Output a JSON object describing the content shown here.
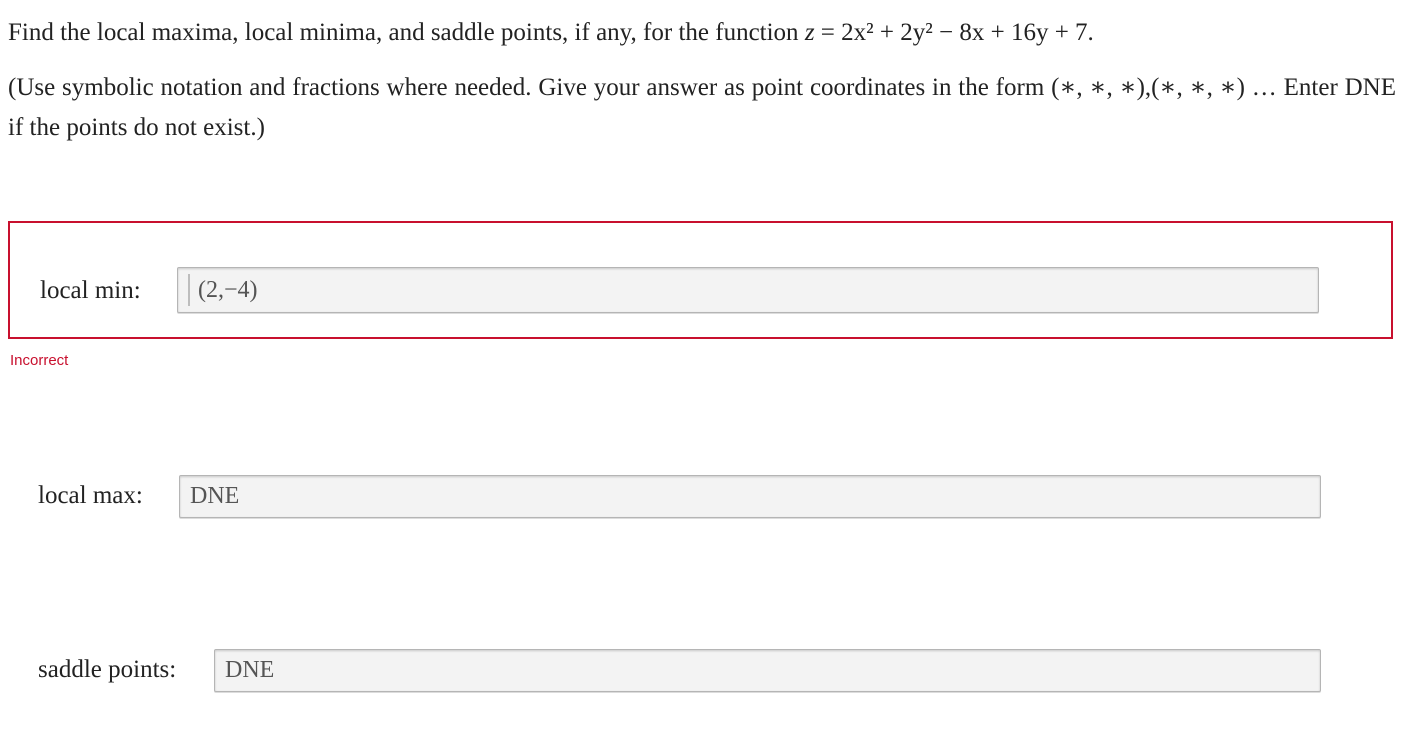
{
  "question": {
    "prefix": "Find the local maxima, local minima, and saddle points, if any, for the function",
    "z_var": "z",
    "equals": " = ",
    "function_expr": "2x² + 2y² − 8x + 16y + 7",
    "period": "."
  },
  "instructions": "(Use symbolic notation and fractions where needed. Give your answer as point coordinates in the form (∗, ∗, ∗),(∗, ∗, ∗) … Enter DNE if the points do not exist.)",
  "fields": {
    "local_min": {
      "label": "local min:",
      "value": "(2,−4)",
      "status": "Incorrect",
      "status_color": "#c8102e"
    },
    "local_max": {
      "label": "local max:",
      "value": "DNE"
    },
    "saddle_points": {
      "label": "saddle points:",
      "value": "DNE"
    }
  }
}
